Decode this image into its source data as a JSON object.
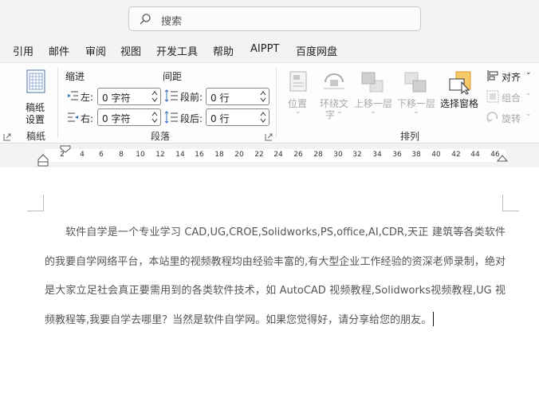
{
  "search": {
    "placeholder": "搜索"
  },
  "tabs": [
    "引用",
    "邮件",
    "审阅",
    "视图",
    "开发工具",
    "帮助",
    "AIPPT",
    "百度网盘"
  ],
  "ribbon": {
    "paper": {
      "button": "稿纸",
      "button2": "设置",
      "group": "稿纸"
    },
    "paragraph": {
      "indent_header": "缩进",
      "spacing_header": "间距",
      "left_label": "左:",
      "left_value": "0 字符",
      "right_label": "右:",
      "right_value": "0 字符",
      "before_label": "段前:",
      "before_value": "0 行",
      "after_label": "段后:",
      "after_value": "0 行",
      "group": "段落"
    },
    "arrange": {
      "position": "位置",
      "wrap_text_1": "环绕文",
      "wrap_text_2": "字",
      "bring_forward": "上移一层",
      "send_backward": "下移一层",
      "selection_pane": "选择窗格",
      "align": "对齐",
      "group_btn": "组合",
      "rotate": "旋转",
      "group": "排列"
    }
  },
  "ruler": {
    "ticks": [
      "2",
      "4",
      "6",
      "8",
      "10",
      "12",
      "14",
      "16",
      "18",
      "20",
      "22",
      "24",
      "26",
      "28",
      "30",
      "32",
      "34",
      "36",
      "38",
      "40",
      "42",
      "44",
      "46"
    ]
  },
  "document": {
    "text": "软件自学是一个专业学习 CAD,UG,CROE,Solidworks,PS,office,AI,CDR,天正 建筑等各类软件的我要自学网络平台，本站里的视频教程均由经验丰富的,有大型企业工作经验的资深老师录制，绝对是大家立足社会真正要需用到的各类软件技术，如 AutoCAD 视频教程,Solidworks视频教程,UG 视频教程等,我要自学去哪里？当然是软件自学网。如果您觉得好，请分享给您的朋友。"
  }
}
